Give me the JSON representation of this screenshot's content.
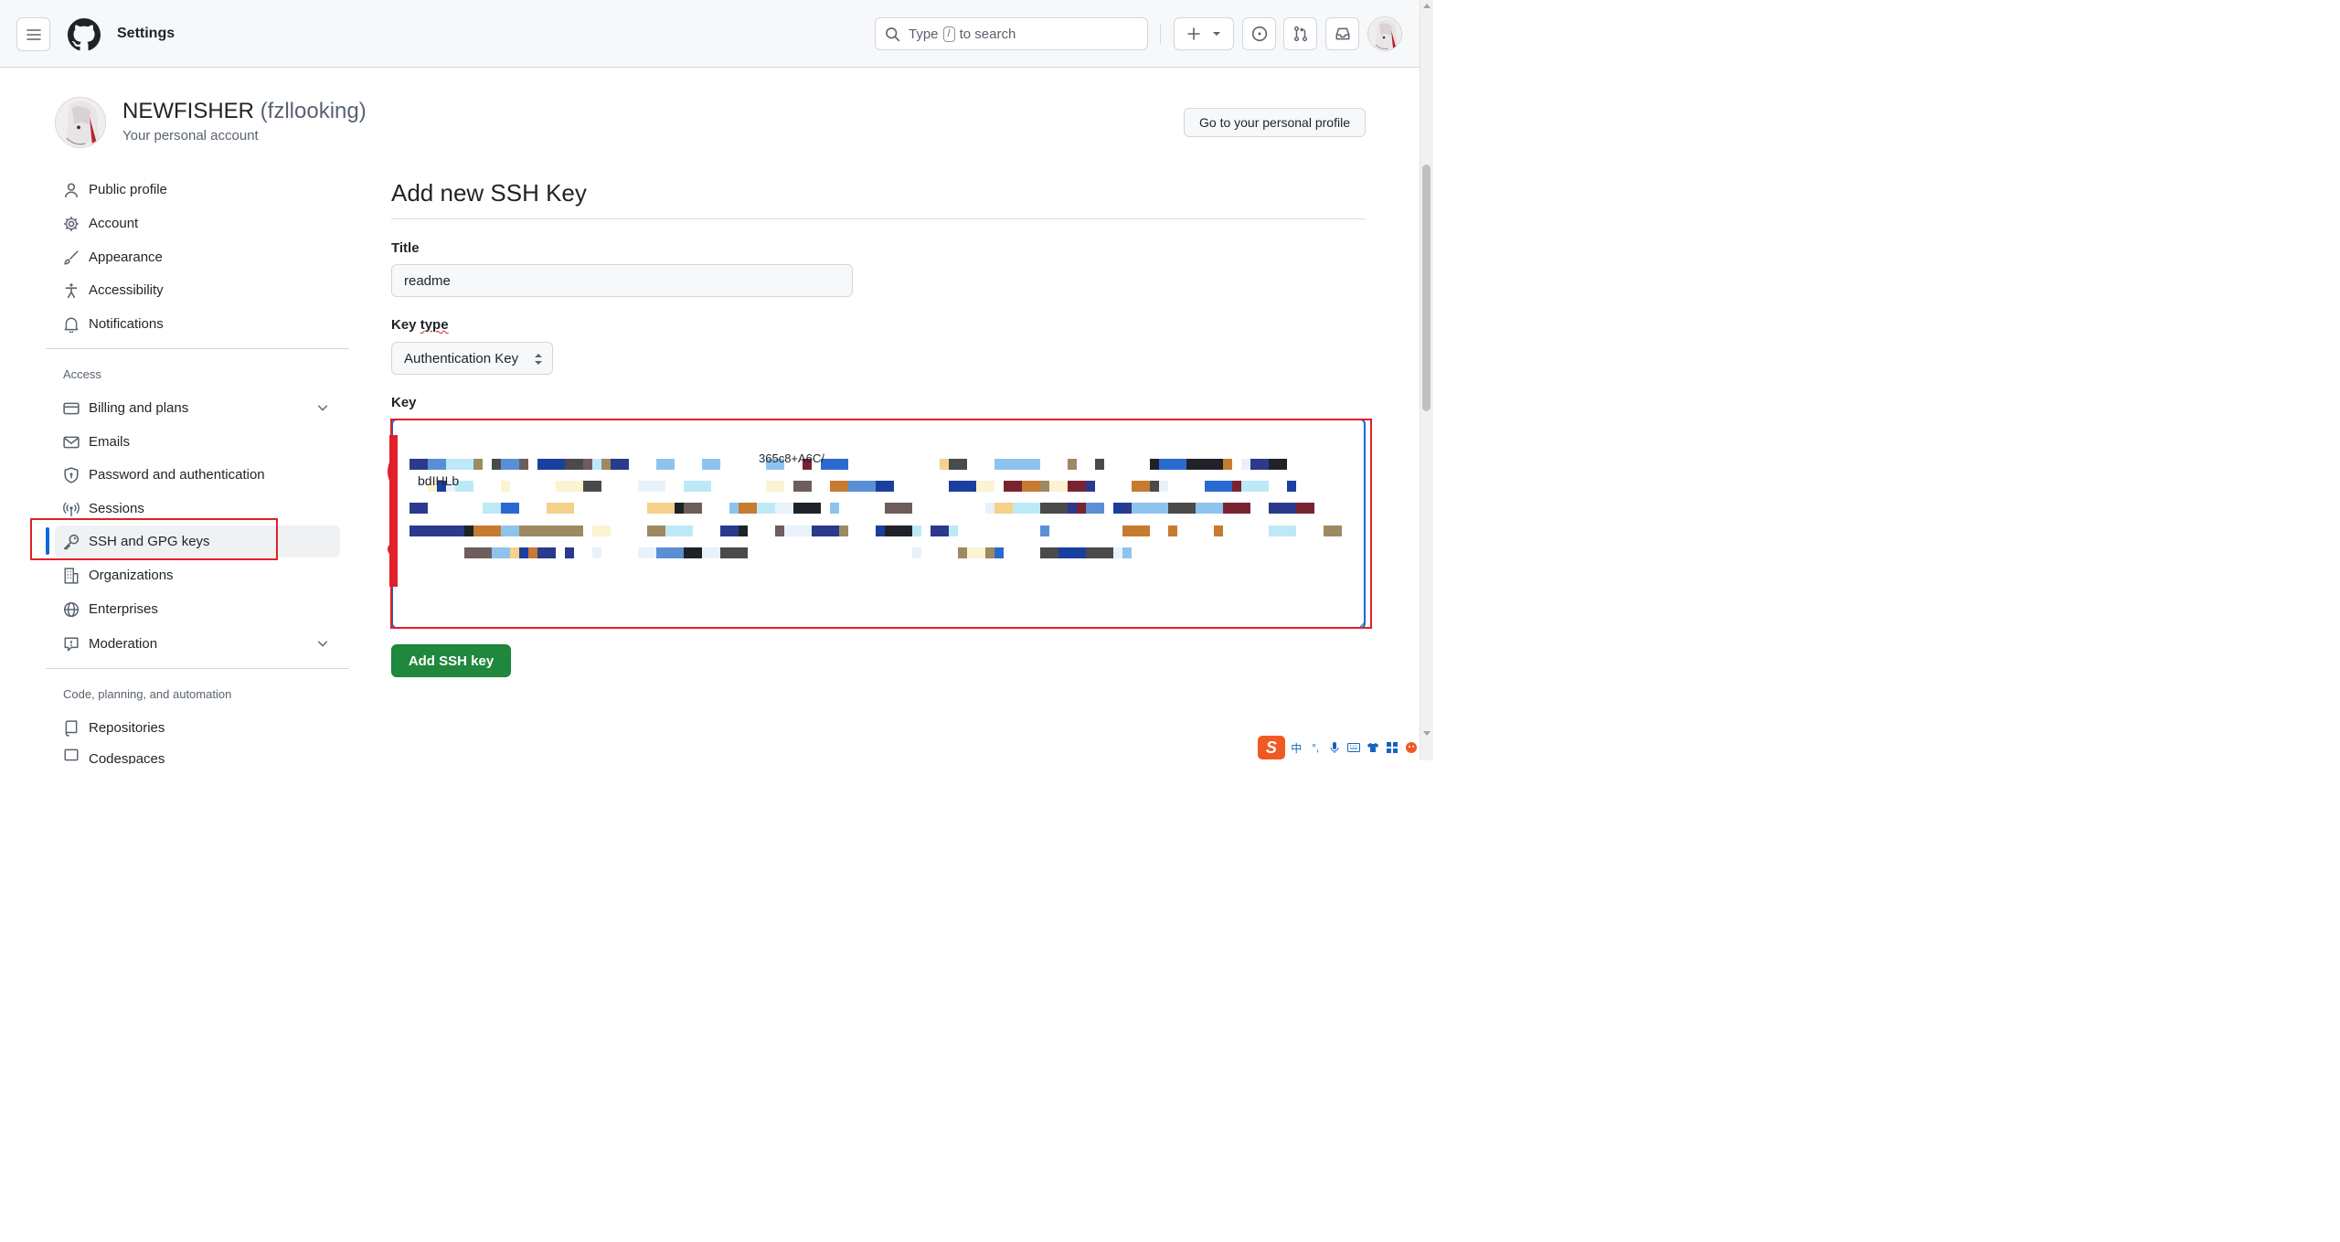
{
  "header": {
    "title": "Settings",
    "search_prefix": "Type",
    "search_key": "/",
    "search_suffix": "to search"
  },
  "user": {
    "display_name": "NEWFISHER",
    "login": "(fzllooking)",
    "subtitle": "Your personal account",
    "profile_button": "Go to your personal profile"
  },
  "sidebar": {
    "items": [
      {
        "label": "Public profile",
        "icon": "person-icon"
      },
      {
        "label": "Account",
        "icon": "gear-icon"
      },
      {
        "label": "Appearance",
        "icon": "paintbrush-icon"
      },
      {
        "label": "Accessibility",
        "icon": "accessibility-icon"
      },
      {
        "label": "Notifications",
        "icon": "bell-icon"
      }
    ],
    "access_heading": "Access",
    "access_items": [
      {
        "label": "Billing and plans",
        "icon": "credit-card-icon"
      },
      {
        "label": "Emails",
        "icon": "mail-icon"
      },
      {
        "label": "Password and authentication",
        "icon": "shield-lock-icon"
      },
      {
        "label": "Sessions",
        "icon": "broadcast-icon"
      },
      {
        "label": "SSH and GPG keys",
        "icon": "key-icon",
        "active": true
      },
      {
        "label": "Organizations",
        "icon": "organization-icon"
      },
      {
        "label": "Enterprises",
        "icon": "globe-icon"
      },
      {
        "label": "Moderation",
        "icon": "report-icon"
      }
    ],
    "code_heading": "Code, planning, and automation",
    "code_items": [
      {
        "label": "Repositories",
        "icon": "repo-icon"
      },
      {
        "label": "Codespaces",
        "icon": "codespaces-icon"
      }
    ]
  },
  "form": {
    "heading": "Add new SSH Key",
    "title_label": "Title",
    "title_value": "readme",
    "key_type_label_a": "Key",
    "key_type_label_b": "type",
    "key_type_value": "Authentication Key",
    "key_label": "Key",
    "key_visible_fragment_1": "bdIHLb",
    "key_visible_fragment_2": "365c8+A6C/",
    "submit_label": "Add SSH key"
  },
  "ime": {
    "logo": "S",
    "mode": "中"
  },
  "colors": {
    "accent_blue": "#0969da",
    "primary_green": "#1f883d",
    "annotation_red": "#e0202a"
  }
}
